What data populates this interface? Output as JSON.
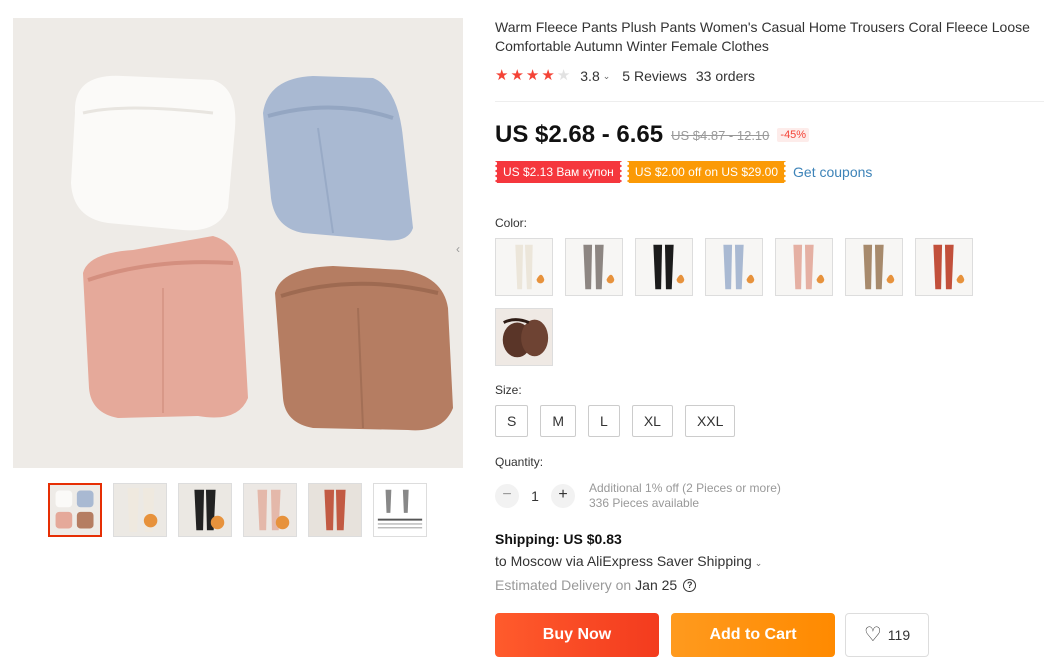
{
  "product": {
    "title": "Warm Fleece Pants Plush Pants Women's Casual Home Trousers Coral Fleece Loose Comfortable Autumn Winter Female Clothes",
    "rating": "3.8",
    "rating_stars": 4,
    "reviews": "5 Reviews",
    "orders": "33 orders"
  },
  "price": {
    "current": "US $2.68 - 6.65",
    "original": "US $4.87 - 12.10",
    "discount": "-45%"
  },
  "coupons": {
    "first": "US $2.13 Вам купон",
    "second": "US $2.00 off on US $29.00",
    "link": "Get coupons"
  },
  "colors": {
    "label": "Color:",
    "options": [
      "white",
      "grey",
      "black",
      "blue",
      "pink",
      "khaki",
      "red",
      "brown"
    ]
  },
  "sizes": {
    "label": "Size:",
    "options": [
      "S",
      "M",
      "L",
      "XL",
      "XXL"
    ]
  },
  "quantity": {
    "label": "Quantity:",
    "value": "1",
    "minus": "−",
    "plus": "+",
    "note_line1": "Additional 1% off (2 Pieces or more)",
    "note_line2": "336 Pieces available"
  },
  "shipping": {
    "title": "Shipping: US $0.83",
    "route": "to Moscow via AliExpress Saver Shipping",
    "delivery_label": "Estimated Delivery on",
    "delivery_date": "Jan 25"
  },
  "actions": {
    "buy_now": "Buy Now",
    "add_to_cart": "Add to Cart",
    "wishlist_count": "119"
  },
  "colors_accent": {
    "price_red": "#f44336",
    "coupon_red": "#f5373d",
    "coupon_orange": "#fb9a06",
    "link_blue": "#3d83b8"
  }
}
